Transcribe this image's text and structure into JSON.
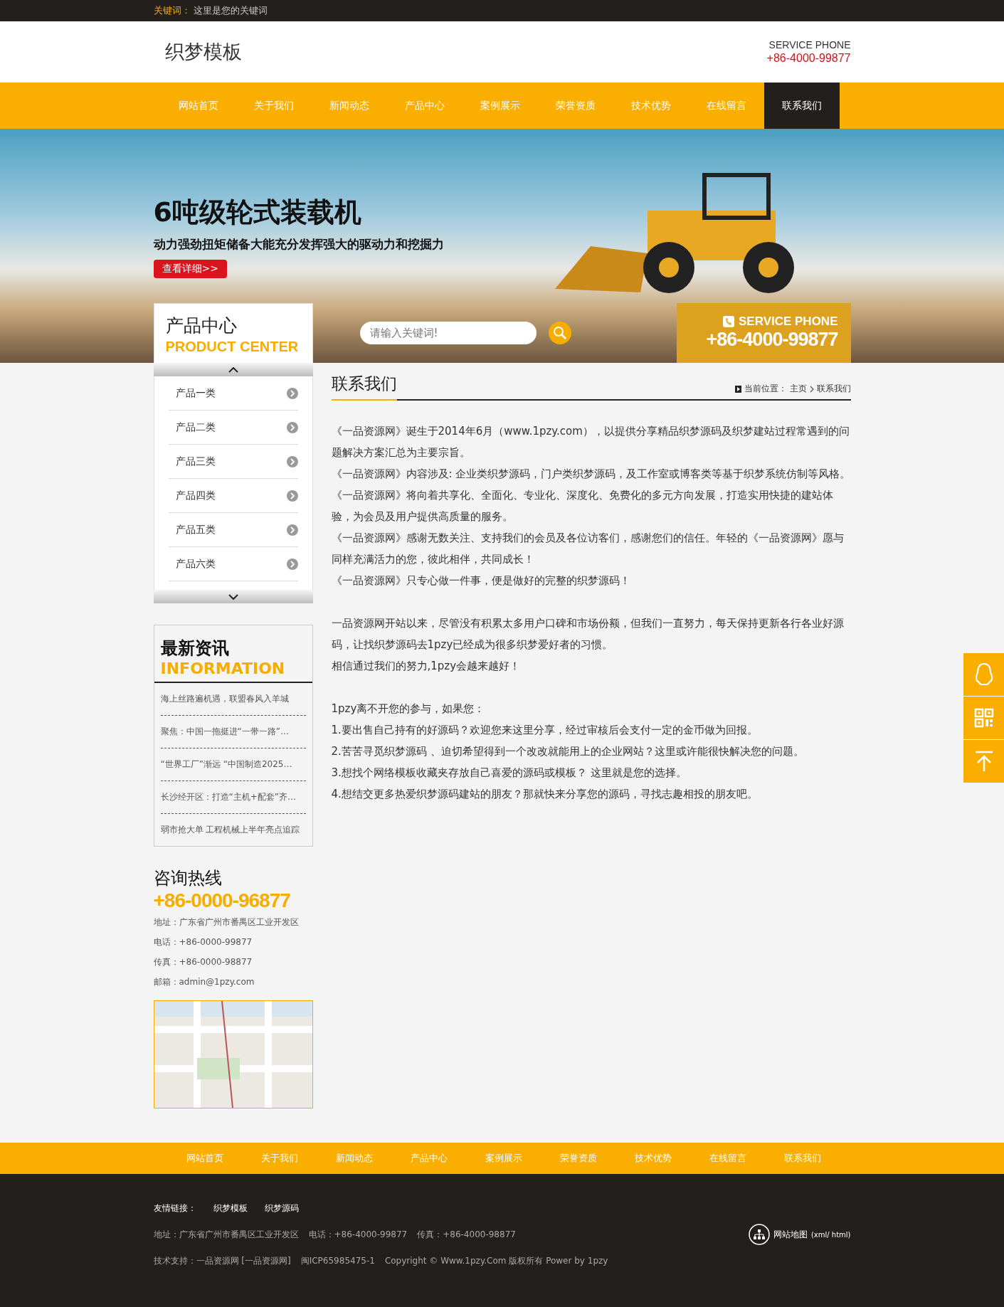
{
  "top_bar": {
    "label": "关键词：",
    "text": "这里是您的关键词"
  },
  "header": {
    "logo": "织梦模板",
    "service_label": "SERVICE PHONE",
    "phone": "+86-4000-99877"
  },
  "nav": [
    {
      "label": "网站首页",
      "selected": false
    },
    {
      "label": "关于我们",
      "selected": false
    },
    {
      "label": "新闻动态",
      "selected": false
    },
    {
      "label": "产品中心",
      "selected": false
    },
    {
      "label": "案例展示",
      "selected": false
    },
    {
      "label": "荣誉资质",
      "selected": false
    },
    {
      "label": "技术优势",
      "selected": false
    },
    {
      "label": "在线留言",
      "selected": false
    },
    {
      "label": "联系我们",
      "selected": true
    }
  ],
  "banner": {
    "title": "6吨级轮式装载机",
    "subtitle": "动力强劲扭矩储备大能充分发挥强大的驱动力和挖掘力",
    "button": "查看详细>>"
  },
  "search": {
    "placeholder": "请输入关键词!"
  },
  "service": {
    "label": "SERVICE PHONE",
    "phone": "+86-4000-99877"
  },
  "product_center": {
    "title_cn": "产品中心",
    "title_en": "PRODUCT CENTER",
    "items": [
      "产品一类",
      "产品二类",
      "产品三类",
      "产品四类",
      "产品五类",
      "产品六类"
    ]
  },
  "news": {
    "title_cn": "最新资讯",
    "title_en": "INFORMATION",
    "items": [
      "海上丝路遍机遇，联盟春风入羊城",
      "聚焦：中国一拖挺进“一带一路”…",
      "“世界工厂”渐远 “中国制造2025…",
      "长沙经开区：打造“主机+配套”齐…",
      "弱市抢大单 工程机械上半年亮点追踪"
    ]
  },
  "contact": {
    "title": "咨询热线",
    "phone": "+86-0000-96877",
    "lines": [
      "地址：广东省广州市番禺区工业开发区",
      "电话：+86-0000-99877",
      "传真：+86-0000-98877",
      "邮箱：admin@1pzy.com"
    ]
  },
  "article": {
    "title": "联系我们",
    "breadcrumb": {
      "label": "当前位置：",
      "home": "主页",
      "current": "联系我们"
    },
    "blocks": [
      [
        "《一品资源网》诞生于2014年6月（www.1pzy.com），以提供分享精品织梦源码及织梦建站过程常遇到的问题解决方案汇总为主要宗旨。",
        "《一品资源网》内容涉及: 企业类织梦源码，门户类织梦源码，及工作室或博客类等基于织梦系统仿制等风格。",
        "《一品资源网》将向着共享化、全面化、专业化、深度化、免费化的多元方向发展，打造实用快捷的建站体验，为会员及用户提供高质量的服务。",
        "《一品资源网》感谢无数关注、支持我们的会员及各位访客们，感谢您们的信任。年轻的《一品资源网》愿与同样充满活力的您，彼此相伴，共同成长！",
        "《一品资源网》只专心做一件事，便是做好的完整的织梦源码！"
      ],
      [
        "一品资源网开站以来，尽管没有积累太多用户口碑和市场份额，但我们一直努力，每天保持更新各行各业好源码，让找织梦源码去1pzy已经成为很多织梦爱好者的习惯。",
        "相信通过我们的努力,1pzy会越来越好！"
      ],
      [
        "1pzy离不开您的参与，如果您：",
        "1.要出售自己持有的好源码？欢迎您来这里分享，经过审核后会支付一定的金币做为回报。",
        "2.苦苦寻觅织梦源码 、迫切希望得到一个改改就能用上的企业网站？这里或许能很快解决您的问题。",
        "3.想找个网络模板收藏夹存放自己喜爱的源码或模板？ 这里就是您的选择。",
        "4.想结交更多热爱织梦源码建站的朋友？那就快来分享您的源码，寻找志趣相投的朋友吧。"
      ]
    ]
  },
  "footer_nav": [
    "网站首页",
    "关于我们",
    "新闻动态",
    "产品中心",
    "案例展示",
    "荣誉资质",
    "技术优势",
    "在线留言",
    "联系我们"
  ],
  "footer": {
    "links_label": "友情链接：",
    "links": [
      "织梦模板",
      "织梦源码"
    ],
    "info": [
      "地址：广东省广州市番禺区工业开发区",
      "电话：+86-4000-99877",
      "传真：+86-4000-98877"
    ],
    "sitemap": "网站地图",
    "sitemap_formats": "(xml/ html)",
    "support": [
      "技术支持：一品资源网 [一品资源网]",
      "闽ICP65985475-1",
      "Copyright © Www.1pzy.Com 版权所有 Power by 1pzy"
    ]
  }
}
